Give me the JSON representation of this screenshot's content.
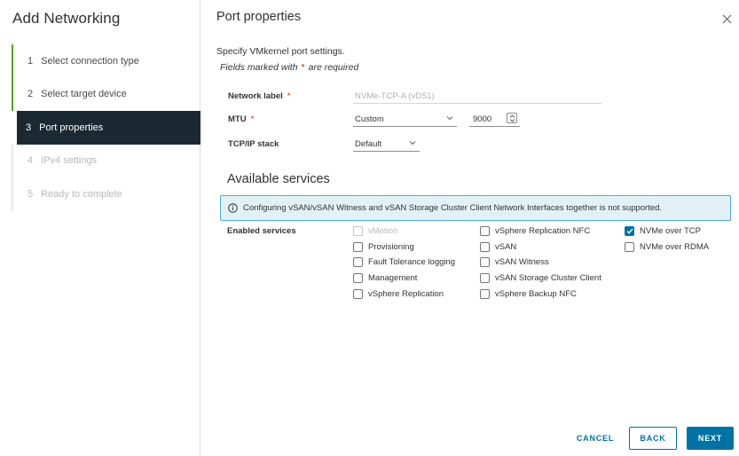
{
  "wizard": {
    "title": "Add Networking",
    "steps": [
      {
        "num": "1",
        "label": "Select connection type"
      },
      {
        "num": "2",
        "label": "Select target device"
      },
      {
        "num": "3",
        "label": "Port properties"
      },
      {
        "num": "4",
        "label": "IPv4 settings"
      },
      {
        "num": "5",
        "label": "Ready to complete"
      }
    ]
  },
  "page": {
    "title": "Port properties",
    "description": "Specify VMkernel port settings.",
    "required_prefix": "Fields marked with",
    "required_star": "*",
    "required_suffix": "are required"
  },
  "form": {
    "network_label": {
      "label": "Network label",
      "star": "*",
      "value": "NVMe-TCP-A (vDS1)"
    },
    "mtu": {
      "label": "MTU",
      "star": "*",
      "mode": "Custom",
      "value": "9000"
    },
    "tcpip_stack": {
      "label": "TCP/IP stack",
      "value": "Default"
    }
  },
  "services": {
    "section_title": "Available services",
    "alert_text": "Configuring vSAN/vSAN Witness and vSAN Storage Cluster Client Network Interfaces together is not supported.",
    "enabled_label": "Enabled services",
    "col1": [
      {
        "label": "vMotion",
        "checked": false,
        "disabled": true
      },
      {
        "label": "Provisioning",
        "checked": false,
        "disabled": false
      },
      {
        "label": "Fault Tolerance logging",
        "checked": false,
        "disabled": false
      },
      {
        "label": "Management",
        "checked": false,
        "disabled": false
      },
      {
        "label": "vSphere Replication",
        "checked": false,
        "disabled": false
      }
    ],
    "col2": [
      {
        "label": "vSphere Replication NFC",
        "checked": false,
        "disabled": false
      },
      {
        "label": "vSAN",
        "checked": false,
        "disabled": false
      },
      {
        "label": "vSAN Witness",
        "checked": false,
        "disabled": false
      },
      {
        "label": "vSAN Storage Cluster Client",
        "checked": false,
        "disabled": false
      },
      {
        "label": "vSphere Backup NFC",
        "checked": false,
        "disabled": false
      }
    ],
    "col3": [
      {
        "label": "NVMe over TCP",
        "checked": true,
        "disabled": false
      },
      {
        "label": "NVMe over RDMA",
        "checked": false,
        "disabled": false
      }
    ]
  },
  "footer": {
    "cancel": "CANCEL",
    "back": "BACK",
    "next": "NEXT"
  },
  "colors": {
    "accent": "#0072a3",
    "step_done": "#5aa220",
    "step_current_bg": "#1b2a32",
    "alert_border": "#49afd9",
    "alert_bg": "#e1f1f6",
    "required": "#c92100"
  }
}
